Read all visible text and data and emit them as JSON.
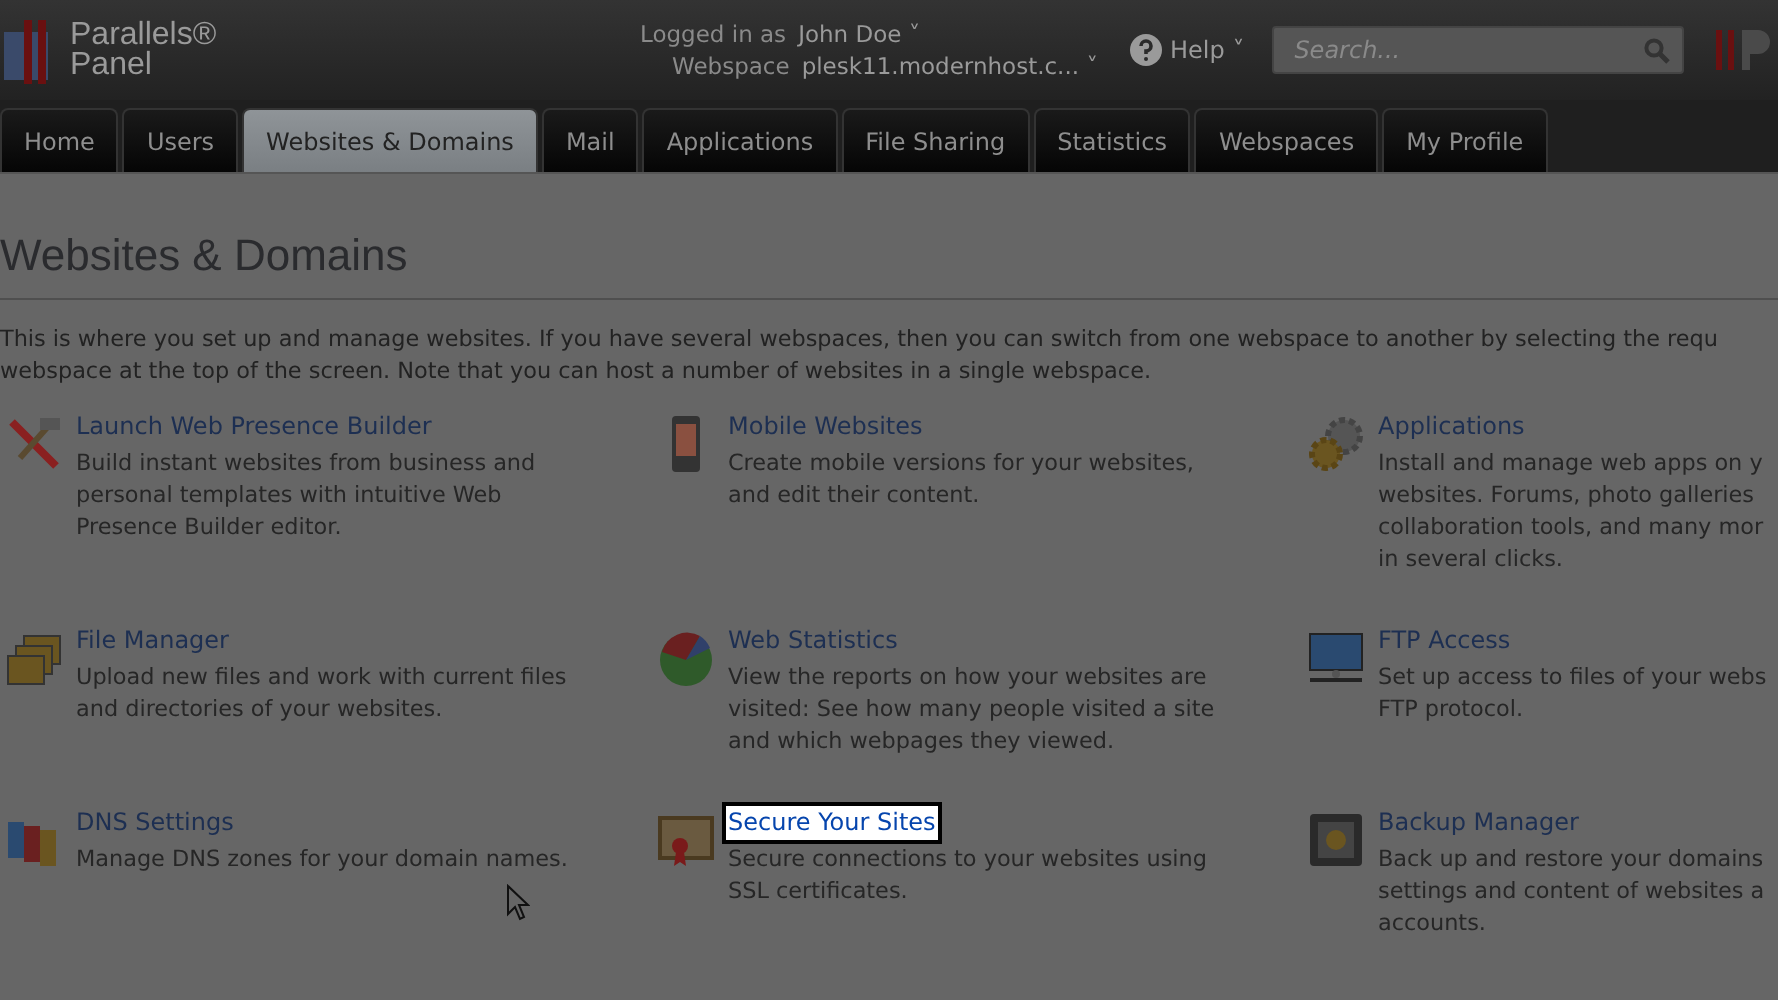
{
  "header": {
    "logo": {
      "brand": "Parallels®",
      "product": "Panel"
    },
    "login": {
      "label": "Logged in as",
      "user": "John Doe",
      "caret": "˅"
    },
    "webspace": {
      "label": "Webspace",
      "value": "plesk11.modernhost.c...",
      "caret": "˅"
    },
    "help": {
      "label": "Help",
      "caret": "˅"
    },
    "search": {
      "placeholder": "Search..."
    }
  },
  "tabs": [
    {
      "label": "Home",
      "selected": false
    },
    {
      "label": "Users",
      "selected": false
    },
    {
      "label": "Websites & Domains",
      "selected": true
    },
    {
      "label": "Mail",
      "selected": false
    },
    {
      "label": "Applications",
      "selected": false
    },
    {
      "label": "File Sharing",
      "selected": false
    },
    {
      "label": "Statistics",
      "selected": false
    },
    {
      "label": "Webspaces",
      "selected": false
    },
    {
      "label": "My Profile",
      "selected": false
    }
  ],
  "page": {
    "title": "Websites & Domains",
    "intro": [
      "This is where you set up and manage websites. If you have several webspaces, then you can switch from one webspace to another by selecting the requ",
      "webspace at the top of the screen. Note that you can host a number of websites in a single webspace."
    ]
  },
  "tools": [
    {
      "kind": "builder",
      "title": "Launch Web Presence Builder",
      "highlighted": false,
      "lines": [
        "Build instant websites from business and",
        "personal templates with intuitive Web",
        "Presence Builder editor."
      ]
    },
    {
      "kind": "mobile",
      "title": "Mobile Websites",
      "highlighted": false,
      "lines": [
        "Create mobile versions for your websites,",
        "and edit their content."
      ]
    },
    {
      "kind": "apps",
      "title": "Applications",
      "highlighted": false,
      "lines": [
        "Install and manage web apps on y",
        "websites. Forums, photo galleries",
        "collaboration tools, and many mor",
        "in several clicks."
      ]
    },
    {
      "kind": "files",
      "title": "File Manager",
      "highlighted": false,
      "lines": [
        "Upload new files and work with current files",
        "and directories of your websites."
      ]
    },
    {
      "kind": "stats",
      "title": "Web Statistics",
      "highlighted": false,
      "lines": [
        "View the reports on how your websites are",
        "visited: See how many people visited a site",
        "and which webpages they viewed."
      ]
    },
    {
      "kind": "ftp",
      "title": "FTP Access",
      "highlighted": false,
      "lines": [
        "Set up access to files of your webs",
        "FTP protocol."
      ]
    },
    {
      "kind": "dns",
      "title": "DNS Settings",
      "highlighted": false,
      "lines": [
        "Manage DNS zones for your domain names."
      ]
    },
    {
      "kind": "ssl",
      "title": "Secure Your Sites",
      "highlighted": true,
      "lines": [
        "Secure connections to your websites using",
        "SSL certificates."
      ]
    },
    {
      "kind": "backup",
      "title": "Backup Manager",
      "highlighted": false,
      "lines": [
        "Back up and restore your domains",
        "settings and content of websites a",
        "accounts."
      ]
    }
  ]
}
